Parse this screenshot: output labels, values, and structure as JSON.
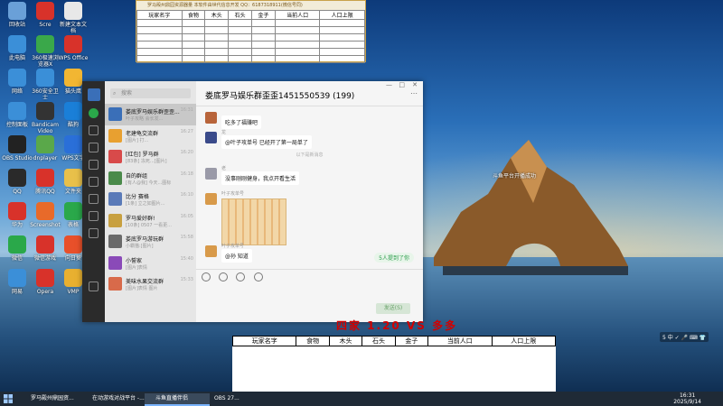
{
  "desktop": {
    "icons": [
      {
        "label": "回收站",
        "icon": "recycle-bin-icon",
        "color": "#6aa0d8"
      },
      {
        "label": "Scre",
        "icon": "app-red-icon",
        "color": "#d8322a"
      },
      {
        "label": "新建文本文档",
        "icon": "text-file-icon",
        "color": "#e8e8e8"
      },
      {
        "label": "此电脑",
        "icon": "this-pc-icon",
        "color": "#3b8fd8"
      },
      {
        "label": "360极速浏览器X",
        "icon": "browser-icon",
        "color": "#3aa84a"
      },
      {
        "label": "WPS Office",
        "icon": "wps-icon",
        "color": "#d8322a"
      },
      {
        "label": "网络",
        "icon": "network-icon",
        "color": "#3b8fd8"
      },
      {
        "label": "360安全卫士",
        "icon": "security-icon",
        "color": "#3a8fd8"
      },
      {
        "label": "猫头鹰",
        "icon": "owl-icon",
        "color": "#f2b632"
      },
      {
        "label": "控制面板",
        "icon": "control-panel-icon",
        "color": "#3b8fd8"
      },
      {
        "label": "Bandicam Video",
        "icon": "bandicam-icon",
        "color": "#333333"
      },
      {
        "label": "酷狗",
        "icon": "kugou-icon",
        "color": "#1a7fd8"
      },
      {
        "label": "OBS Studio",
        "icon": "obs-icon",
        "color": "#222222"
      },
      {
        "label": "dnplayer",
        "icon": "emulator-icon",
        "color": "#5aa84a"
      },
      {
        "label": "WPS文字",
        "icon": "wps-writer-icon",
        "color": "#2a6fd8"
      },
      {
        "label": "QQ",
        "icon": "qq-icon",
        "color": "#2a2a2a"
      },
      {
        "label": "腾讯QQ",
        "icon": "tencent-icon",
        "color": "#d8322a"
      },
      {
        "label": "文件夹",
        "icon": "folder-icon",
        "color": "#e8c04a"
      },
      {
        "label": "华为",
        "icon": "huawei-icon",
        "color": "#d8322a"
      },
      {
        "label": "Screenshot",
        "icon": "screenshot-icon",
        "color": "#e86a2a"
      },
      {
        "label": "表格",
        "icon": "sheet-icon",
        "color": "#2aa84a"
      },
      {
        "label": "微信",
        "icon": "wechat-icon",
        "color": "#2aa84a"
      },
      {
        "label": "微信游戏",
        "icon": "game-icon",
        "color": "#d8322a"
      },
      {
        "label": "向日葵",
        "icon": "sunflower-icon",
        "color": "#e8502a"
      },
      {
        "label": "网易",
        "icon": "netease-icon",
        "color": "#3b8fd8"
      },
      {
        "label": "Opera",
        "icon": "opera-icon",
        "color": "#d8322a"
      },
      {
        "label": "VMP",
        "icon": "vmp-icon",
        "color": "#e8b030"
      }
    ],
    "toast": "斗鱼平台开播成功",
    "banner": "四家 1.20 VS 多多",
    "tray_app": "5 中 ✓ 🎤 ⌨ 👕"
  },
  "top_window": {
    "title": "罗马殿州鼎园资源器量  本软件由世代信息开发 QQ：6187318911(微信号同)",
    "headers": [
      "玩家名字",
      "食物",
      "木头",
      "石头",
      "金子",
      "当前人口",
      "人口上限"
    ]
  },
  "bottom_window": {
    "headers": [
      "玩家名字",
      "食物",
      "木头",
      "石头",
      "金子",
      "当前人口",
      "人口上限"
    ]
  },
  "chat": {
    "search_placeholder": "搜索",
    "title": "娄底罗马娱乐群歪歪1451550539 (199)",
    "conversations": [
      {
        "name": "娄底罗马娱乐群歪歪...",
        "preview": "叶子攻略 会长发...",
        "time": "16:31",
        "color": "#3a6fb8",
        "selected": true
      },
      {
        "name": "老建龟交流群",
        "preview": "[图片] 打...",
        "time": "16:27",
        "color": "#e8a030",
        "selected": false
      },
      {
        "name": "[红包] 罗马群",
        "preview": "[83条] 冻死...[图片]",
        "time": "16:20",
        "color": "#d84a4a",
        "selected": false
      },
      {
        "name": "自的群组",
        "preview": "[有人@我] 今天...图标",
        "time": "16:18",
        "color": "#4a8a4a",
        "selected": false
      },
      {
        "name": "比分 赛格",
        "preview": "[1条] 立之如图片...",
        "time": "16:10",
        "color": "#5a7ab8",
        "selected": false
      },
      {
        "name": "罗马爱好群!",
        "preview": "[10条] 0507 一看更...",
        "time": "16:05",
        "color": "#c8a040",
        "selected": false
      },
      {
        "name": "娄底罗马游玩群",
        "preview": "小霸猫:[图片]",
        "time": "15:58",
        "color": "#6a6a6a",
        "selected": false
      },
      {
        "name": "小誓家",
        "preview": "[图片]表情",
        "time": "15:40",
        "color": "#8a4ab8",
        "selected": false
      },
      {
        "name": "美味水果交流群",
        "preview": "[图片]表情 图片",
        "time": "15:33",
        "color": "#d86a4a",
        "selected": false
      }
    ],
    "messages": [
      {
        "sender": "",
        "text": "吃多了福赚吧",
        "kind": "text"
      },
      {
        "sender": "龙",
        "text": "@叶子攻单号 已经开了第一局单了",
        "kind": "text"
      },
      {
        "sender": "",
        "text": "以下是新消息",
        "kind": "system"
      },
      {
        "sender": "老",
        "text": "没事刚刚健身，我点开看生活",
        "kind": "text"
      },
      {
        "sender": "叶子攻单号",
        "text": "",
        "kind": "image"
      },
      {
        "sender": "叶子攻单号",
        "text": "@孙 知道",
        "kind": "text"
      }
    ],
    "mention_tag": "5人提到了你",
    "send_label": "发送(S)"
  },
  "taskbar": {
    "tasks": [
      {
        "label": "罗马殿州鼎园资...",
        "active": false
      },
      {
        "label": "在动游戏对战平台 -...",
        "active": false
      },
      {
        "label": "斗鱼直播伴侣",
        "active": true
      },
      {
        "label": "OBS 27...",
        "active": false
      }
    ],
    "time": "16:31",
    "date": "2025/9/14"
  }
}
